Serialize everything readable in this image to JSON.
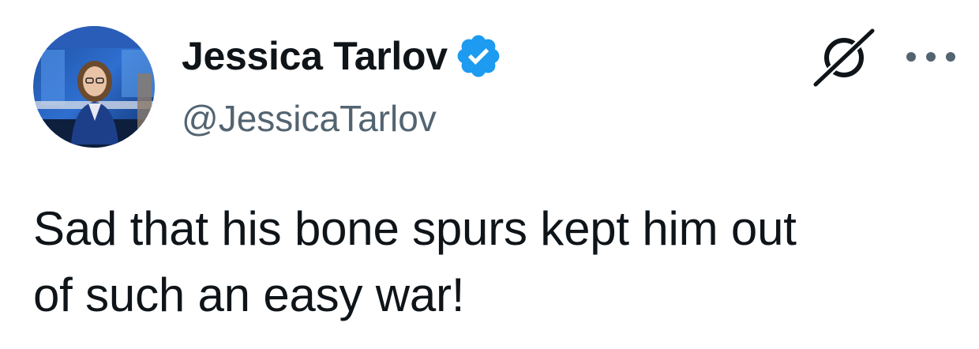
{
  "author": {
    "display_name": "Jessica Tarlov",
    "handle": "@JessicaTarlov",
    "verified": true,
    "avatar_icon": "profile-photo"
  },
  "actions": {
    "grok_icon": "grok-icon",
    "more_icon": "more-options-icon"
  },
  "tweet": {
    "text": "Sad that his bone spurs kept him out\nof such an easy war!"
  },
  "colors": {
    "text_primary": "#0f1419",
    "text_secondary": "#536471",
    "verified_blue": "#1d9bf0",
    "background": "#ffffff"
  }
}
